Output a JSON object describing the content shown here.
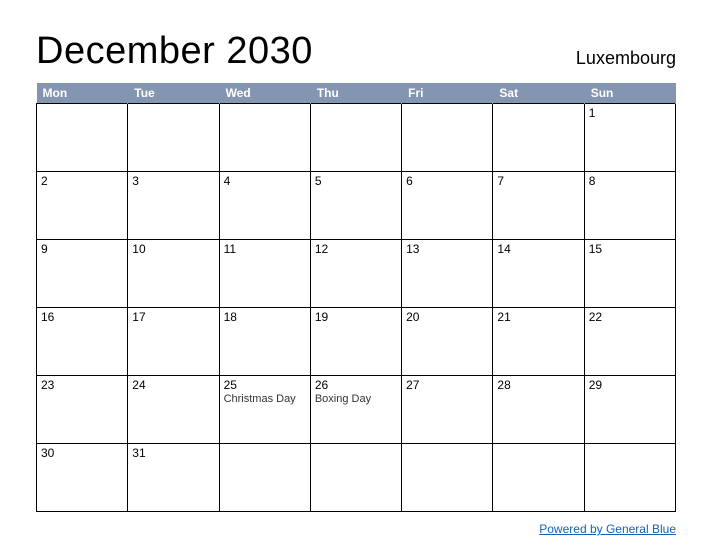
{
  "header": {
    "title": "December 2030",
    "region": "Luxembourg"
  },
  "weekdays": [
    "Mon",
    "Tue",
    "Wed",
    "Thu",
    "Fri",
    "Sat",
    "Sun"
  ],
  "weeks": [
    [
      {
        "day": "",
        "event": ""
      },
      {
        "day": "",
        "event": ""
      },
      {
        "day": "",
        "event": ""
      },
      {
        "day": "",
        "event": ""
      },
      {
        "day": "",
        "event": ""
      },
      {
        "day": "",
        "event": ""
      },
      {
        "day": "1",
        "event": ""
      }
    ],
    [
      {
        "day": "2",
        "event": ""
      },
      {
        "day": "3",
        "event": ""
      },
      {
        "day": "4",
        "event": ""
      },
      {
        "day": "5",
        "event": ""
      },
      {
        "day": "6",
        "event": ""
      },
      {
        "day": "7",
        "event": ""
      },
      {
        "day": "8",
        "event": ""
      }
    ],
    [
      {
        "day": "9",
        "event": ""
      },
      {
        "day": "10",
        "event": ""
      },
      {
        "day": "11",
        "event": ""
      },
      {
        "day": "12",
        "event": ""
      },
      {
        "day": "13",
        "event": ""
      },
      {
        "day": "14",
        "event": ""
      },
      {
        "day": "15",
        "event": ""
      }
    ],
    [
      {
        "day": "16",
        "event": ""
      },
      {
        "day": "17",
        "event": ""
      },
      {
        "day": "18",
        "event": ""
      },
      {
        "day": "19",
        "event": ""
      },
      {
        "day": "20",
        "event": ""
      },
      {
        "day": "21",
        "event": ""
      },
      {
        "day": "22",
        "event": ""
      }
    ],
    [
      {
        "day": "23",
        "event": ""
      },
      {
        "day": "24",
        "event": ""
      },
      {
        "day": "25",
        "event": "Christmas Day"
      },
      {
        "day": "26",
        "event": "Boxing Day"
      },
      {
        "day": "27",
        "event": ""
      },
      {
        "day": "28",
        "event": ""
      },
      {
        "day": "29",
        "event": ""
      }
    ],
    [
      {
        "day": "30",
        "event": ""
      },
      {
        "day": "31",
        "event": ""
      },
      {
        "day": "",
        "event": ""
      },
      {
        "day": "",
        "event": ""
      },
      {
        "day": "",
        "event": ""
      },
      {
        "day": "",
        "event": ""
      },
      {
        "day": "",
        "event": ""
      }
    ]
  ],
  "footer": {
    "link_text": "Powered by General Blue"
  }
}
